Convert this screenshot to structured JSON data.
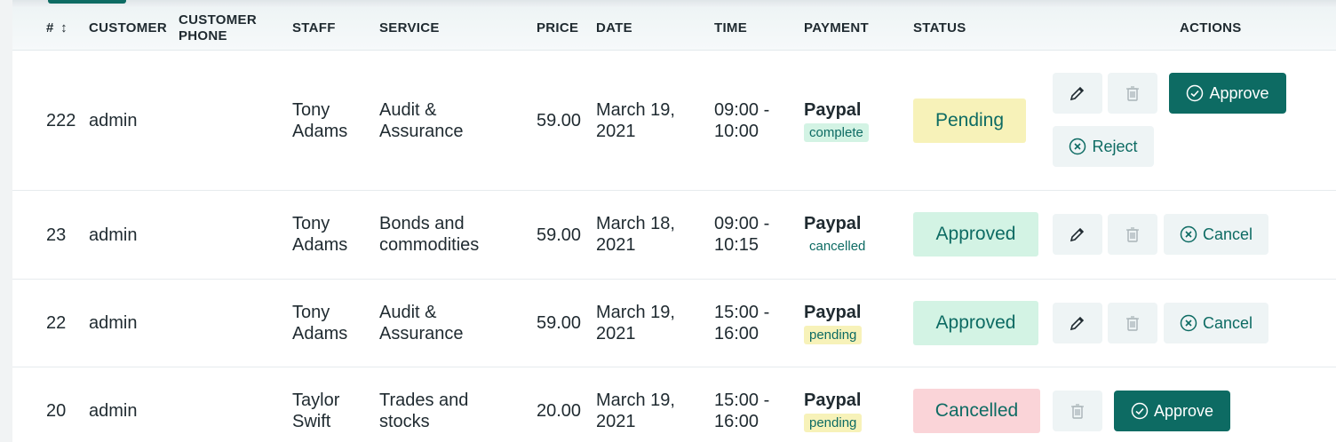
{
  "headers": {
    "id": "#",
    "sort_icon": "↕",
    "customer": "CUSTOMER",
    "customer_phone_1": "CUSTOMER",
    "customer_phone_2": "PHONE",
    "staff": "STAFF",
    "service": "SERVICE",
    "price": "PRICE",
    "date": "DATE",
    "time": "TIME",
    "payment": "PAYMENT",
    "status": "STATUS",
    "actions": "ACTIONS"
  },
  "colors": {
    "accent": "#0d6b63",
    "pending_bg": "#f7f2b9",
    "approved_bg": "#d3f3e4",
    "cancelled_bg": "#fad4d8",
    "action_bg": "#eef4f5"
  },
  "rows": [
    {
      "id": "222",
      "customer": "admin",
      "phone": "",
      "staff_1": "Tony",
      "staff_2": "Adams",
      "service_1": "Audit &",
      "service_2": "Assurance",
      "price": "59.00",
      "date_1": "March 19,",
      "date_2": "2021",
      "time_1": "09:00 -",
      "time_2": "10:00",
      "payment_method": "Paypal",
      "payment_status": "complete",
      "status": "Pending",
      "action_primary": "Approve",
      "action_secondary": "Reject"
    },
    {
      "id": "23",
      "customer": "admin",
      "phone": "",
      "staff_1": "Tony",
      "staff_2": "Adams",
      "service_1": "Bonds and",
      "service_2": "commodities",
      "price": "59.00",
      "date_1": "March 18,",
      "date_2": "2021",
      "time_1": "09:00 -",
      "time_2": "10:15",
      "payment_method": "Paypal",
      "payment_status": "cancelled",
      "status": "Approved",
      "action_secondary": "Cancel"
    },
    {
      "id": "22",
      "customer": "admin",
      "phone": "",
      "staff_1": "Tony",
      "staff_2": "Adams",
      "service_1": "Audit &",
      "service_2": "Assurance",
      "price": "59.00",
      "date_1": "March 19,",
      "date_2": "2021",
      "time_1": "15:00 -",
      "time_2": "16:00",
      "payment_method": "Paypal",
      "payment_status": "pending",
      "status": "Approved",
      "action_secondary": "Cancel"
    },
    {
      "id": "20",
      "customer": "admin",
      "phone": "",
      "staff_1": "Taylor",
      "staff_2": "Swift",
      "service_1": "Trades and",
      "service_2": "stocks",
      "price": "20.00",
      "date_1": "March 19,",
      "date_2": "2021",
      "time_1": "15:00 -",
      "time_2": "16:00",
      "payment_method": "Paypal",
      "payment_status": "pending",
      "status": "Cancelled",
      "action_primary": "Approve"
    }
  ]
}
